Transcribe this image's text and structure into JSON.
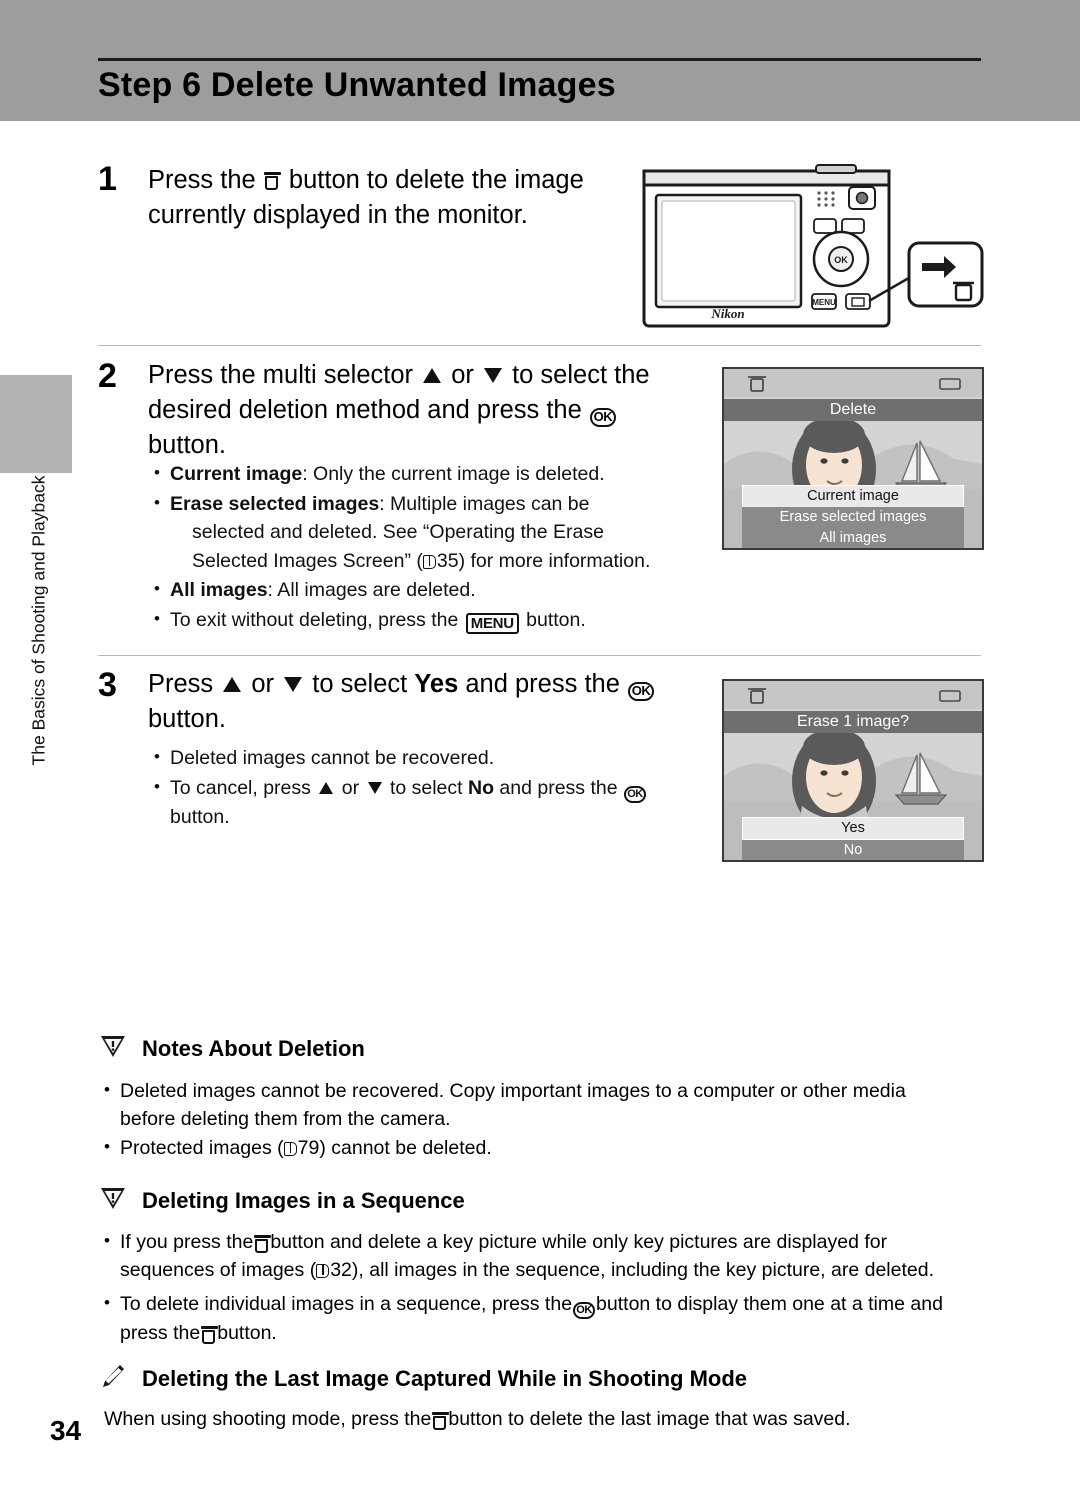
{
  "page": {
    "title": "Step 6 Delete Unwanted Images",
    "number": "34",
    "side_tab_text": "The Basics of Shooting and Playback"
  },
  "steps": [
    {
      "num": "1",
      "text_before": "Press the",
      "text_after": "button to delete the image currently displayed in the monitor."
    },
    {
      "num": "2",
      "line1_a": "Press the multi selector",
      "line1_or": "or",
      "line1_b": "to select the",
      "line2": "desired deletion method and press the",
      "line3": "button."
    },
    {
      "num": "3",
      "a": "Press",
      "or": "or",
      "b": "to select",
      "yes": "Yes",
      "c": "and press the",
      "d": "button."
    }
  ],
  "step2_bullets": {
    "b1_bold": "Current image",
    "b1_rest": ": Only the current image is deleted.",
    "b2_bold": "Erase selected images",
    "b2_rest": ": Multiple images can be",
    "b2_line2": "selected and deleted. See “Operating the Erase",
    "b2_line3_a": "Selected Images Screen” (",
    "b2_ref": "35",
    "b2_line3_b": ") for more information.",
    "b3_bold": "All images",
    "b3_rest": ": All images are deleted.",
    "b4_a": "To exit without deleting, press the",
    "b4_menu": "MENU",
    "b4_b": "button."
  },
  "step3_bullets": {
    "b1": "Deleted images cannot be recovered.",
    "b2_a": "To cancel, press",
    "b2_or": "or",
    "b2_b": "to select",
    "b2_no": "No",
    "b2_c": "and press the",
    "b2_d": "button."
  },
  "notes": [
    {
      "icon": "warning-icon",
      "heading": "Notes About Deletion",
      "lines": [
        "Deleted images cannot be recovered. Copy important images to a computer or other media",
        "before deleting them from the camera."
      ],
      "bullet2_a": "Protected images (",
      "bullet2_ref": "79",
      "bullet2_b": ") cannot be deleted."
    },
    {
      "icon": "warning-icon",
      "heading": "Deleting Images in a Sequence",
      "b1_a": "If you press the",
      "b1_b": "button and delete a key picture while only key pictures are displayed for",
      "b1_c": "sequences of images (",
      "b1_ref": "32",
      "b1_d": "), all images in the sequence, including the key picture, are deleted.",
      "b2_a": "To delete individual images in a sequence, press the",
      "b2_b": "button to display them one at a time and",
      "b2_c": "press the",
      "b2_d": "button."
    },
    {
      "icon": "pencil-icon",
      "heading": "Deleting the Last Image Captured While in Shooting Mode",
      "body_a": "When using shooting mode, press the",
      "body_b": "button to delete the last image that was saved."
    }
  ],
  "lcd_delete": {
    "title": "Delete",
    "options": [
      {
        "label": "Current image",
        "state": "selected"
      },
      {
        "label": "Erase selected images",
        "state": "unselected"
      },
      {
        "label": "All images",
        "state": "unselected"
      }
    ]
  },
  "lcd_confirm": {
    "title": "Erase 1 image?",
    "options": [
      {
        "label": "Yes",
        "state": "selected"
      },
      {
        "label": "No",
        "state": "unselected"
      }
    ]
  },
  "camera": {
    "brand": "Nikon",
    "callout_icon": "trash-button-callout"
  },
  "colors": {
    "header_band": "#9d9d9d",
    "side_tab": "#b4b4b4",
    "lcd_bg": "#d5d5d5",
    "lcd_title_bar": "#6f6f6f",
    "option_unselected": "#8a8a8a"
  }
}
